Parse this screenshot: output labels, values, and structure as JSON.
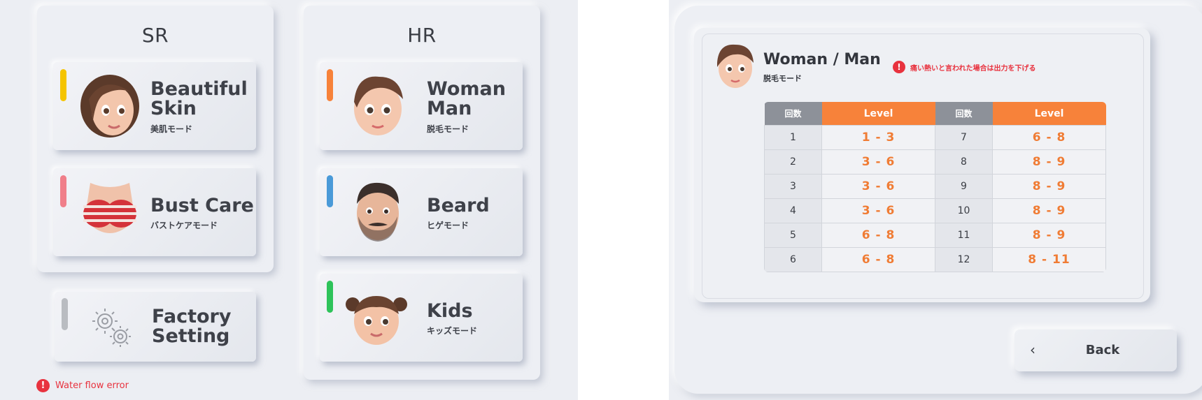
{
  "left_screen": {
    "groups": [
      {
        "title": "SR"
      },
      {
        "title": "HR"
      }
    ],
    "cards": {
      "beautiful_skin": {
        "title": "Beautiful\nSkin",
        "subtitle": "美肌モード",
        "accent": "#f5c400"
      },
      "bust_care": {
        "title": "Bust Care",
        "subtitle": "バストケアモード",
        "accent": "#f07f8a"
      },
      "factory_setting": {
        "title": "Factory\nSetting",
        "subtitle": "",
        "accent": "#b9bcc1"
      },
      "woman_man": {
        "title": "Woman\nMan",
        "subtitle": "脱毛モード",
        "accent": "#f7823a"
      },
      "beard": {
        "title": "Beard",
        "subtitle": "ヒゲモード",
        "accent": "#4a9ad8"
      },
      "kids": {
        "title": "Kids",
        "subtitle": "キッズモード",
        "accent": "#2ec35a"
      }
    },
    "error": {
      "icon": "exclamation-icon",
      "text": "Water flow error"
    }
  },
  "right_screen": {
    "title": "Woman / Man",
    "subtitle": "脱毛モード",
    "warning": "痛い熱いと言われた場合は出力を下げる",
    "table": {
      "headers": [
        "回数",
        "Level",
        "回数",
        "Level"
      ],
      "rows": [
        [
          "1",
          "1  -  3",
          "7",
          "6  -  8"
        ],
        [
          "2",
          "3  -  6",
          "8",
          "8  -  9"
        ],
        [
          "3",
          "3  -  6",
          "9",
          "8  -  9"
        ],
        [
          "4",
          "3  -  6",
          "10",
          "8  -  9"
        ],
        [
          "5",
          "6  -  8",
          "11",
          "8  -  9"
        ],
        [
          "6",
          "6  -  8",
          "12",
          "8  -  11"
        ]
      ]
    },
    "back_button": {
      "label": "Back",
      "icon": "chevron-left-icon"
    }
  },
  "colors": {
    "background": "#eceef3",
    "level_header": "#f7823a",
    "count_header": "#8d9199",
    "error": "#e8323e",
    "level_text": "#f07c34"
  }
}
